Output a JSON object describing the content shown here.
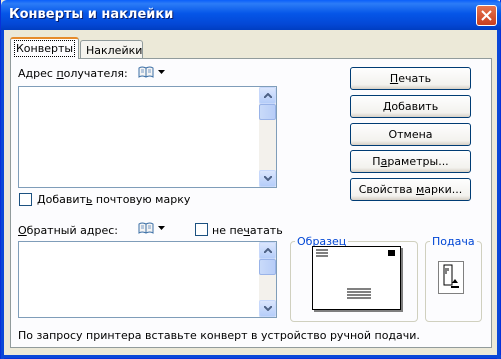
{
  "window": {
    "title": "Конверты и наклейки"
  },
  "tabs": [
    {
      "label": "Конверты",
      "active": true
    },
    {
      "label": "Наклейки",
      "active": false
    }
  ],
  "recipient": {
    "label_pre": "Адрес ",
    "label_accel": "п",
    "label_post": "олучателя:",
    "value": ""
  },
  "add_postage": {
    "label_pre": "Добавит",
    "label_accel": "ь",
    "label_post": " почтовую марку",
    "checked": false
  },
  "return_address": {
    "label_pre": "",
    "label_accel": "О",
    "label_post": "братный адрес:",
    "value": ""
  },
  "omit": {
    "label_pre": "не пе",
    "label_accel": "ч",
    "label_post": "атать",
    "checked": false
  },
  "buttons": {
    "print_pre": "",
    "print_accel": "П",
    "print_post": "ечать",
    "add_pre": "",
    "add_accel": "Д",
    "add_post": "обавить",
    "cancel": "Отмена",
    "options_pre": "П",
    "options_accel": "а",
    "options_post": "раметры...",
    "postage_props_pre": "Свойства ",
    "postage_props_accel": "м",
    "postage_props_post": "арки..."
  },
  "preview": {
    "label": "Образец"
  },
  "feed": {
    "label": "Подача"
  },
  "status": {
    "text": "По запросу принтера вставьте конверт в устройство ручной подачи."
  },
  "colors": {
    "title_bar": "#0556e8",
    "dialog_bg": "#ece9d8",
    "group_label": "#0046d5",
    "tab_highlight": "#e68b2c"
  }
}
